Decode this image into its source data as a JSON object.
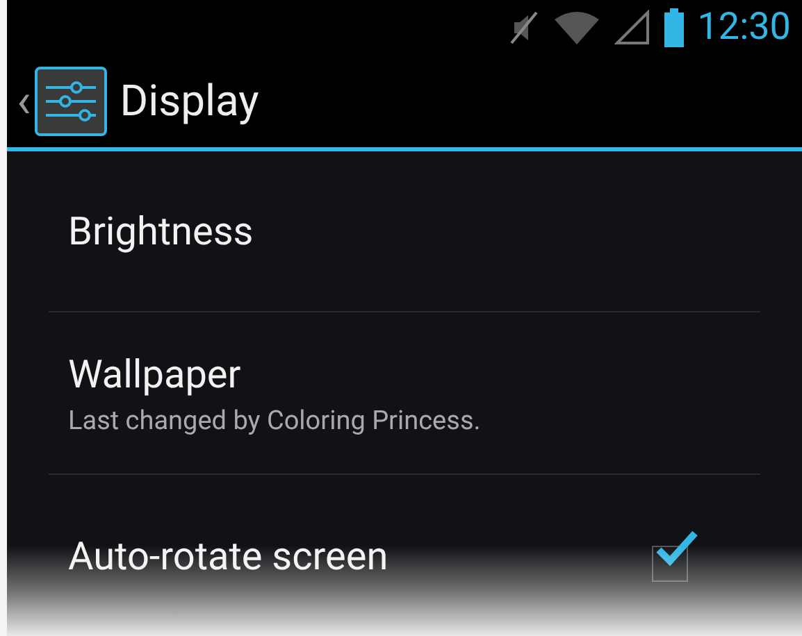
{
  "status_bar": {
    "time": "12:30"
  },
  "action_bar": {
    "back": "‹",
    "title": "Display"
  },
  "settings": [
    {
      "kind": "plain",
      "title": "Brightness"
    },
    {
      "kind": "summary",
      "title": "Wallpaper",
      "summary": "Last changed by Coloring Princess."
    },
    {
      "kind": "checkbox",
      "title": "Auto-rotate screen",
      "checked": true
    }
  ]
}
